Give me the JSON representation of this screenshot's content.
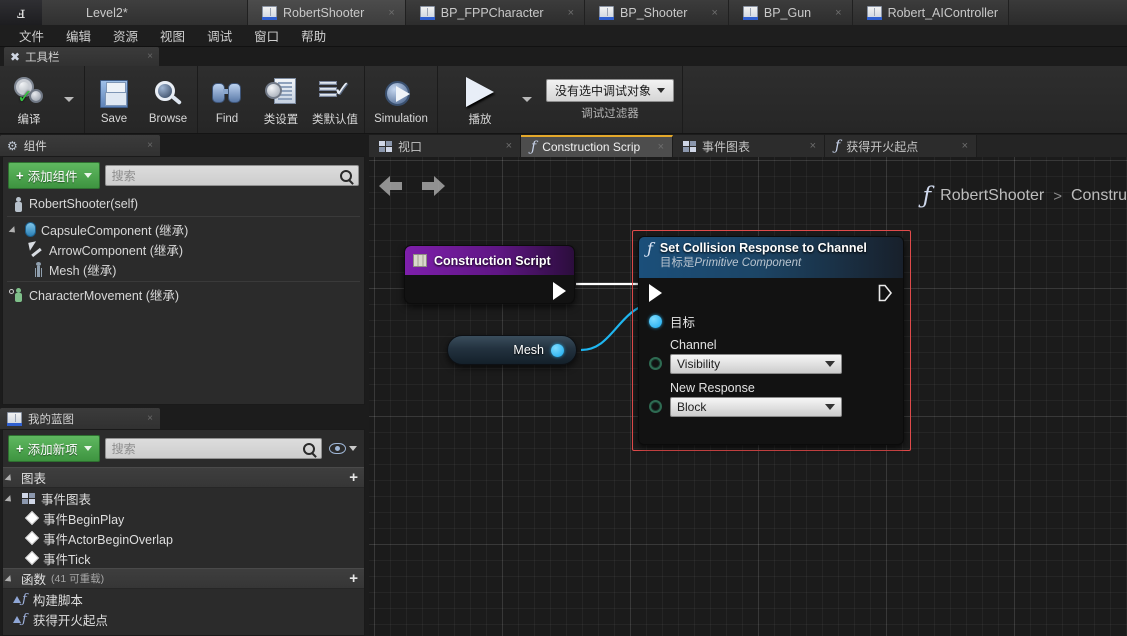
{
  "window": {
    "logo": "ue-logo",
    "tabs": [
      {
        "label": "Level2*",
        "icon": "level-icon",
        "active": false,
        "type": "level"
      },
      {
        "label": "RobertShooter",
        "icon": "blueprint-icon",
        "active": true,
        "type": "blueprint"
      },
      {
        "label": "BP_FPPCharacter",
        "icon": "blueprint-icon",
        "active": false,
        "type": "blueprint"
      },
      {
        "label": "BP_Shooter",
        "icon": "blueprint-icon",
        "active": false,
        "type": "blueprint"
      },
      {
        "label": "BP_Gun",
        "icon": "blueprint-icon",
        "active": false,
        "type": "blueprint"
      },
      {
        "label": "Robert_AIController",
        "icon": "blueprint-icon",
        "active": false,
        "type": "blueprint"
      }
    ],
    "close_glyph": "×"
  },
  "menu": {
    "items": [
      "文件",
      "编辑",
      "资源",
      "视图",
      "调试",
      "窗口",
      "帮助"
    ]
  },
  "toolbar": {
    "tab_label": "工具栏",
    "tab_icon": "wrench-icon",
    "compile_label": "编译",
    "save_label": "Save",
    "browse_label": "Browse",
    "find_label": "Find",
    "class_settings_label": "类设置",
    "class_defaults_label": "类默认值",
    "simulation_label": "Simulation",
    "play_label": "播放",
    "debug_object_value": "没有选中调试对象",
    "debug_filter_label": "调试过滤器"
  },
  "components_panel": {
    "tab_label": "组件",
    "tab_icon": "components-icon",
    "add_button": "添加组件",
    "search_placeholder": "搜索",
    "tree": [
      {
        "label": "RobertShooter(self)",
        "icon": "pawn-icon",
        "indent": 0,
        "expander": false
      },
      {
        "label": "CapsuleComponent (继承)",
        "icon": "capsule-icon",
        "indent": 0,
        "expander": true
      },
      {
        "label": "ArrowComponent (继承)",
        "icon": "arrow-icon",
        "indent": 1,
        "expander": false
      },
      {
        "label": "Mesh (继承)",
        "icon": "mesh-icon",
        "indent": 1,
        "expander": false
      },
      {
        "label": "CharacterMovement (继承)",
        "icon": "character-movement-icon",
        "indent": 0,
        "expander": false
      }
    ]
  },
  "myblueprint_panel": {
    "tab_label": "我的蓝图",
    "tab_icon": "blueprint-icon",
    "add_button": "添加新项",
    "search_placeholder": "搜索",
    "sections": [
      {
        "title": "图表",
        "count": "",
        "items": [
          {
            "label": "事件图表",
            "icon": "graph-icon",
            "indent": 0,
            "expander": true
          },
          {
            "label": "事件BeginPlay",
            "icon": "event-diamond-icon",
            "indent": 1,
            "expander": false
          },
          {
            "label": "事件ActorBeginOverlap",
            "icon": "event-diamond-icon",
            "indent": 1,
            "expander": false
          },
          {
            "label": "事件Tick",
            "icon": "event-diamond-icon",
            "indent": 1,
            "expander": false
          }
        ]
      },
      {
        "title": "函数",
        "count": "(41 可重载)",
        "items": [
          {
            "label": "构建脚本",
            "icon": "function-icon",
            "indent": 0,
            "expander": false
          },
          {
            "label": "获得开火起点",
            "icon": "function-icon",
            "indent": 0,
            "expander": false
          }
        ]
      }
    ]
  },
  "graph": {
    "tabs": [
      {
        "label": "视口",
        "icon": "viewport-icon",
        "active": false
      },
      {
        "label": "Construction Scrip",
        "icon": "function-f-icon",
        "active": true
      },
      {
        "label": "事件图表",
        "icon": "graph-icon",
        "active": false
      },
      {
        "label": "获得开火起点",
        "icon": "function-f-icon",
        "active": false
      }
    ],
    "breadcrumb": {
      "root": "RobertShooter",
      "separator": ">",
      "current": "Constru"
    },
    "nav_back": "back-arrow",
    "nav_forward": "forward-arrow",
    "nodes": [
      {
        "id": "construction-script",
        "title": "Construction Script",
        "type": "event",
        "selected": false,
        "header_color": "#7e1fab"
      },
      {
        "id": "mesh-get",
        "title": "Mesh",
        "type": "variable-get",
        "selected": false
      },
      {
        "id": "set-collision-response-to-channel",
        "title": "Set Collision Response to Channel",
        "subtitle_prefix": "目标是",
        "subtitle_class": "Primitive Component",
        "type": "function-call",
        "selected": true,
        "selection_color": "#e14b4b",
        "header_color": "#1b4f7a",
        "pins": [
          {
            "name": "目标",
            "kind": "object-input"
          },
          {
            "name": "Channel",
            "kind": "enum-input",
            "value": "Visibility"
          },
          {
            "name": "New Response",
            "kind": "enum-input",
            "value": "Block"
          }
        ]
      }
    ]
  }
}
